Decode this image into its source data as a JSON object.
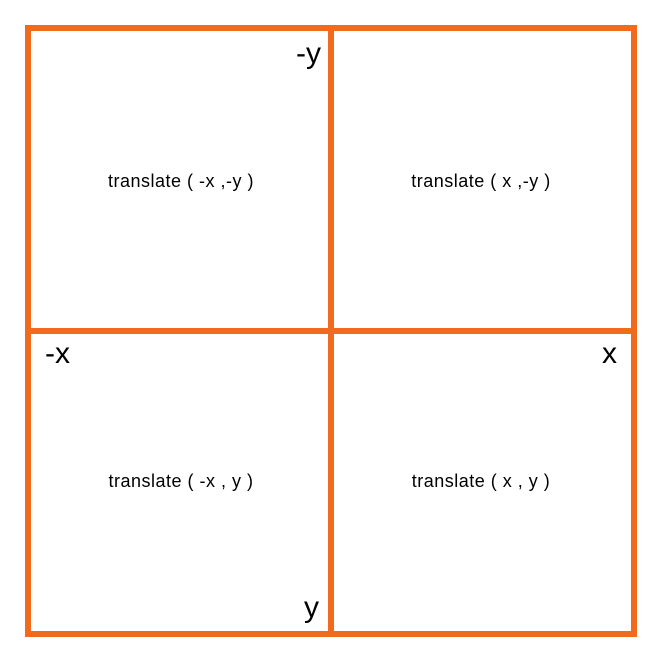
{
  "axes": {
    "neg_y": "-y",
    "neg_x": "-x",
    "pos_x": "x",
    "pos_y": "y"
  },
  "quadrants": {
    "top_left": "translate ( -x ,-y )",
    "top_right": "translate ( x ,-y )",
    "bottom_left": "translate ( -x , y )",
    "bottom_right": "translate ( x , y )"
  },
  "colors": {
    "border": "#f26b1d",
    "text": "#000000",
    "background": "#ffffff"
  }
}
